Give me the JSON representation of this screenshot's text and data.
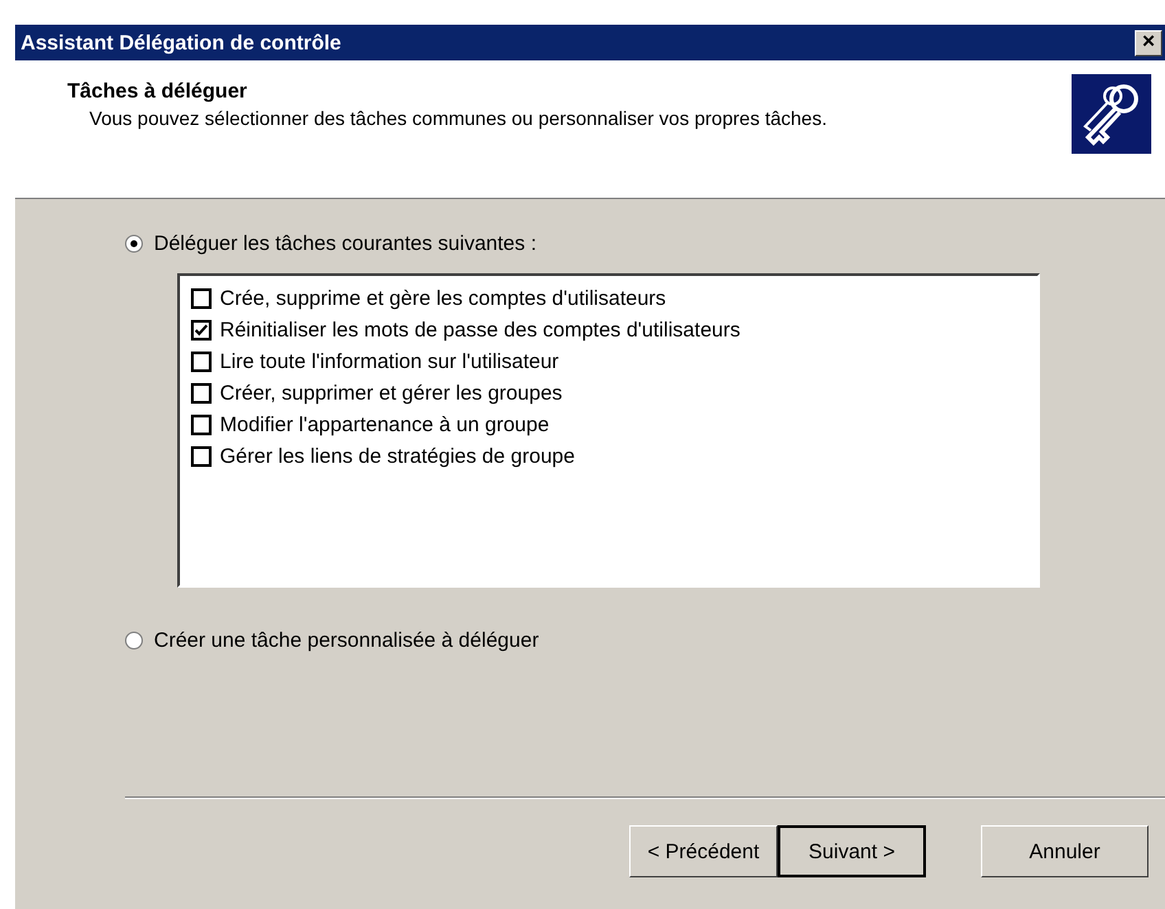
{
  "window": {
    "title": "Assistant Délégation de contrôle",
    "close": "×"
  },
  "header": {
    "title": "Tâches à déléguer",
    "subtitle": "Vous pouvez sélectionner des tâches communes ou personnaliser vos propres tâches."
  },
  "options": [
    {
      "label": "Déléguer les tâches courantes suivantes :",
      "selected": true
    },
    {
      "label": "Créer une tâche personnalisée à déléguer",
      "selected": false
    }
  ],
  "tasks": [
    {
      "label": "Crée, supprime et gère les comptes d'utilisateurs",
      "checked": false
    },
    {
      "label": "Réinitialiser les mots de passe des comptes d'utilisateurs",
      "checked": true
    },
    {
      "label": "Lire toute l'information sur l'utilisateur",
      "checked": false
    },
    {
      "label": "Créer, supprimer et gérer les groupes",
      "checked": false
    },
    {
      "label": "Modifier l'appartenance à un groupe",
      "checked": false
    },
    {
      "label": "Gérer les liens de stratégies de groupe",
      "checked": false
    }
  ],
  "buttons": [
    {
      "label": "< Précédent",
      "default": false
    },
    {
      "label": "Suivant >",
      "default": true
    },
    {
      "label": "Annuler",
      "default": false
    }
  ]
}
